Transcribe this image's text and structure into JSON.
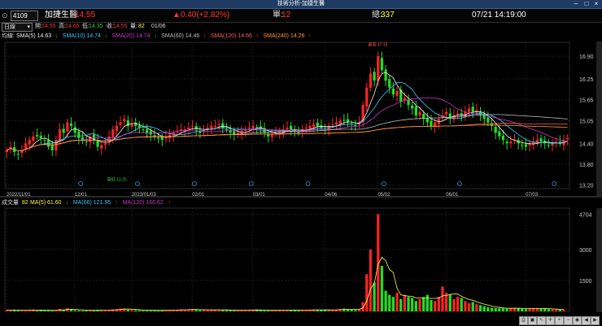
{
  "window": {
    "title": "技術分析-加捷生醫"
  },
  "info": {
    "code": "4109",
    "name": "加捷生醫",
    "price": "14.55",
    "change": "▲0.40(+2.82%)",
    "single_label": "單:",
    "single_value": "12",
    "total_label": "總:",
    "total_value": "337",
    "datetime": "07/21 14:19:00"
  },
  "ohlc": {
    "period": "日線",
    "open_label": "開:",
    "open": "14.55",
    "high_label": "高:",
    "high": "14.65",
    "low_label": "低:",
    "low": "14.35",
    "close_label": "收:",
    "close": "14.55",
    "vol_label": "量:",
    "vol": "82",
    "date": "01/06"
  },
  "ma": {
    "title": "均線:",
    "items": [
      {
        "text": "SMA(5) 14.63",
        "arrow": "↓",
        "color": "#f0f0f0",
        "arrow_color": "#33cc33"
      },
      {
        "text": "SMA(10) 14.74",
        "arrow": "↓",
        "color": "#33ccff",
        "arrow_color": "#33cc33"
      },
      {
        "text": "SMA(20) 14.74",
        "arrow": "↓",
        "color": "#cc33cc",
        "arrow_color": "#33cc33"
      },
      {
        "text": "SMA(60) 14.46",
        "arrow": "↑",
        "color": "#bbbbbb",
        "arrow_color": "#ff3333"
      },
      {
        "text": "SMA(120) 14.66",
        "arrow": "↑",
        "color": "#ff5a5a",
        "arrow_color": "#ff3333"
      },
      {
        "text": "SMA(240) 14.26",
        "arrow": "↑",
        "color": "#ff9933",
        "arrow_color": "#ff3333"
      }
    ]
  },
  "vol": {
    "title": "成交量",
    "value": "82",
    "items": [
      {
        "text": "MA(5) 61.60",
        "arrow": "↓",
        "color": "#ffff44",
        "arrow_color": "#33cc33"
      },
      {
        "text": "MA(66) 121.95",
        "arrow": "↑",
        "color": "#33ccff",
        "arrow_color": "#ff3333"
      },
      {
        "text": "MA(120) 166.62",
        "arrow": "↑",
        "color": "#cc33cc",
        "arrow_color": "#ff3333"
      }
    ]
  },
  "price_axis": [
    "16.90",
    "16.25",
    "15.65",
    "15.05",
    "14.40",
    "13.80",
    "13.20"
  ],
  "vol_axis": [
    "4704",
    "3000",
    "1500"
  ],
  "date_axis": [
    "2022/11/01",
    "12/01",
    "2023/01/03",
    "02/01",
    "03/01",
    "04/06",
    "05/02",
    "06/01",
    "07/03"
  ],
  "annotations": {
    "high": "最高 17.15",
    "low": "最低 13.25"
  },
  "colors": {
    "up": "#ff2222",
    "down": "#22dd22",
    "bg": "#000000",
    "grid": "#1c1c1c"
  },
  "toolbar_icons": [
    "print-icon",
    "save-icon",
    "cursor-icon",
    "crosshair-icon",
    "zoom-in-icon",
    "zoom-out-icon",
    "eye-icon",
    "prev-icon",
    "next-icon"
  ],
  "chart_data": {
    "type": "candlestick",
    "y_range": [
      13.1,
      17.3
    ],
    "x_dates": [
      "2022/11/01",
      "12/01",
      "2023/01/03",
      "02/01",
      "03/01",
      "04/06",
      "05/02",
      "06/01",
      "07/03"
    ],
    "close": [
      14.2,
      14.3,
      14.15,
      14.1,
      14.2,
      14.4,
      14.5,
      14.6,
      14.6,
      14.55,
      14.5,
      14.3,
      14.2,
      14.5,
      14.8,
      14.7,
      15.0,
      14.9,
      14.7,
      14.55,
      14.5,
      14.45,
      14.6,
      14.5,
      14.3,
      14.35,
      14.4,
      14.6,
      14.8,
      14.9,
      15.0,
      15.1,
      14.9,
      14.95,
      14.9,
      14.85,
      14.8,
      14.7,
      14.65,
      14.6,
      14.55,
      14.5,
      14.6,
      14.65,
      14.7,
      14.75,
      14.8,
      14.8,
      14.85,
      14.9,
      14.8,
      14.7,
      14.75,
      14.85,
      14.9,
      14.9,
      14.95,
      14.85,
      14.8,
      14.7,
      14.65,
      14.7,
      14.75,
      14.8,
      14.85,
      14.9,
      14.85,
      14.8,
      14.7,
      14.6,
      14.65,
      14.7,
      14.75,
      14.8,
      14.85,
      14.8,
      14.75,
      14.7,
      14.8,
      14.85,
      14.9,
      14.95,
      14.9,
      14.85,
      14.8,
      14.9,
      14.95,
      15.0,
      15.05,
      15.05,
      15.0,
      14.95,
      14.9,
      15.0,
      15.5,
      16.0,
      16.4,
      16.2,
      16.9,
      16.5,
      16.2,
      16.0,
      15.8,
      15.9,
      15.6,
      15.7,
      15.5,
      15.4,
      15.2,
      15.3,
      15.1,
      15.0,
      14.9,
      15.0,
      15.1,
      15.2,
      15.3,
      15.1,
      15.2,
      15.25,
      15.2,
      15.3,
      15.4,
      15.3,
      15.35,
      15.2,
      15.1,
      15.0,
      14.9,
      14.7,
      14.6,
      14.5,
      14.4,
      14.45,
      14.5,
      14.4,
      14.35,
      14.3,
      14.4,
      14.45,
      14.5,
      14.45,
      14.4,
      14.35,
      14.4,
      14.45,
      14.4,
      14.5,
      14.55
    ],
    "volume": [
      60,
      40,
      80,
      50,
      45,
      70,
      60,
      90,
      40,
      55,
      60,
      50,
      40,
      80,
      120,
      70,
      150,
      90,
      60,
      50,
      40,
      45,
      60,
      50,
      70,
      40,
      50,
      80,
      90,
      110,
      130,
      140,
      80,
      70,
      60,
      55,
      50,
      45,
      60,
      50,
      40,
      45,
      55,
      60,
      70,
      80,
      90,
      75,
      100,
      110,
      70,
      60,
      65,
      70,
      80,
      75,
      90,
      60,
      55,
      50,
      45,
      55,
      60,
      70,
      80,
      75,
      60,
      55,
      50,
      45,
      50,
      55,
      60,
      65,
      70,
      60,
      55,
      50,
      60,
      70,
      80,
      90,
      70,
      60,
      55,
      70,
      80,
      90,
      110,
      130,
      100,
      80,
      70,
      120,
      450,
      1800,
      3000,
      1400,
      4704,
      2200,
      1000,
      800,
      700,
      900,
      600,
      800,
      700,
      650,
      500,
      600,
      700,
      800,
      550,
      500,
      700,
      1200,
      900,
      800,
      600,
      700,
      650,
      500,
      400,
      450,
      350,
      300,
      250,
      200,
      180,
      160,
      150,
      140,
      130,
      160,
      170,
      150,
      120,
      110,
      140,
      160,
      150,
      130,
      120,
      110,
      100,
      90,
      80,
      82
    ]
  }
}
